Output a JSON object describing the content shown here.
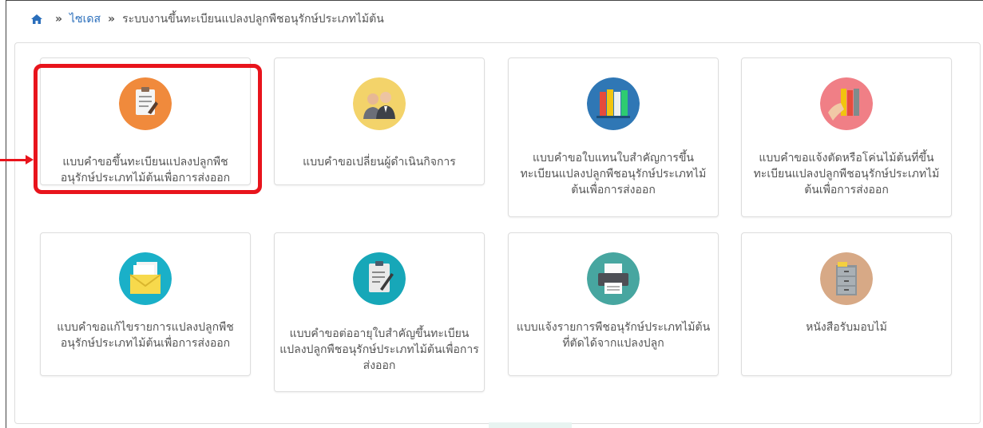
{
  "breadcrumb": {
    "home_icon": "home-icon",
    "separator": "»",
    "site": "ไซเดส",
    "current": "ระบบงานขึ้นทะเบียนแปลงปลูกพืชอนุรักษ์ประเภทไม้ต้น"
  },
  "cards": [
    {
      "label": "แบบคำขอขึ้นทะเบียนแปลงปลูกพืชอนุรักษ์ประเภทไม้ต้นเพื่อการส่งออก",
      "icon": "clipboard-form-icon",
      "color": "#f08a3c"
    },
    {
      "label": "แบบคำขอเปลี่ยนผู้ดำเนินกิจการ",
      "icon": "business-people-icon",
      "color": "#f3d36a"
    },
    {
      "label": "แบบคำขอใบแทนใบสำคัญการขึ้นทะเบียนแปลงปลูกพืชอนุรักษ์ประเภทไม้ต้นเพื่อการส่งออก",
      "icon": "binders-icon",
      "color": "#2f77b5"
    },
    {
      "label": "แบบคำขอแจ้งตัดหรือโค่นไม้ต้นที่ขึ้นทะเบียนแปลงปลูกพืชอนุรักษ์ประเภทไม้ต้นเพื่อการส่งออก",
      "icon": "hand-binders-icon",
      "color": "#f07f86"
    },
    {
      "label": "แบบคำขอแก้ไขรายการแปลงปลูกพืชอนุรักษ์ประเภทไม้ต้นเพื่อการส่งออก",
      "icon": "envelope-documents-icon",
      "color": "#1ab0c8"
    },
    {
      "label": "แบบคำขอต่ออายุใบสำคัญขึ้นทะเบียนแปลงปลูกพืชอนุรักษ์ประเภทไม้ต้นเพื่อการส่งออก",
      "icon": "clipboard-pen-icon",
      "color": "#17a7b8"
    },
    {
      "label": "แบบแจ้งรายการพืชอนุรักษ์ประเภทไม้ต้นที่ตัดได้จากแปลงปลูก",
      "icon": "printer-icon",
      "color": "#47a6a0"
    },
    {
      "label": "หนังสือรับมอบไม้",
      "icon": "filing-cabinet-icon",
      "color": "#d7a986"
    }
  ],
  "annotation": {
    "highlight_color": "#e8141c"
  }
}
